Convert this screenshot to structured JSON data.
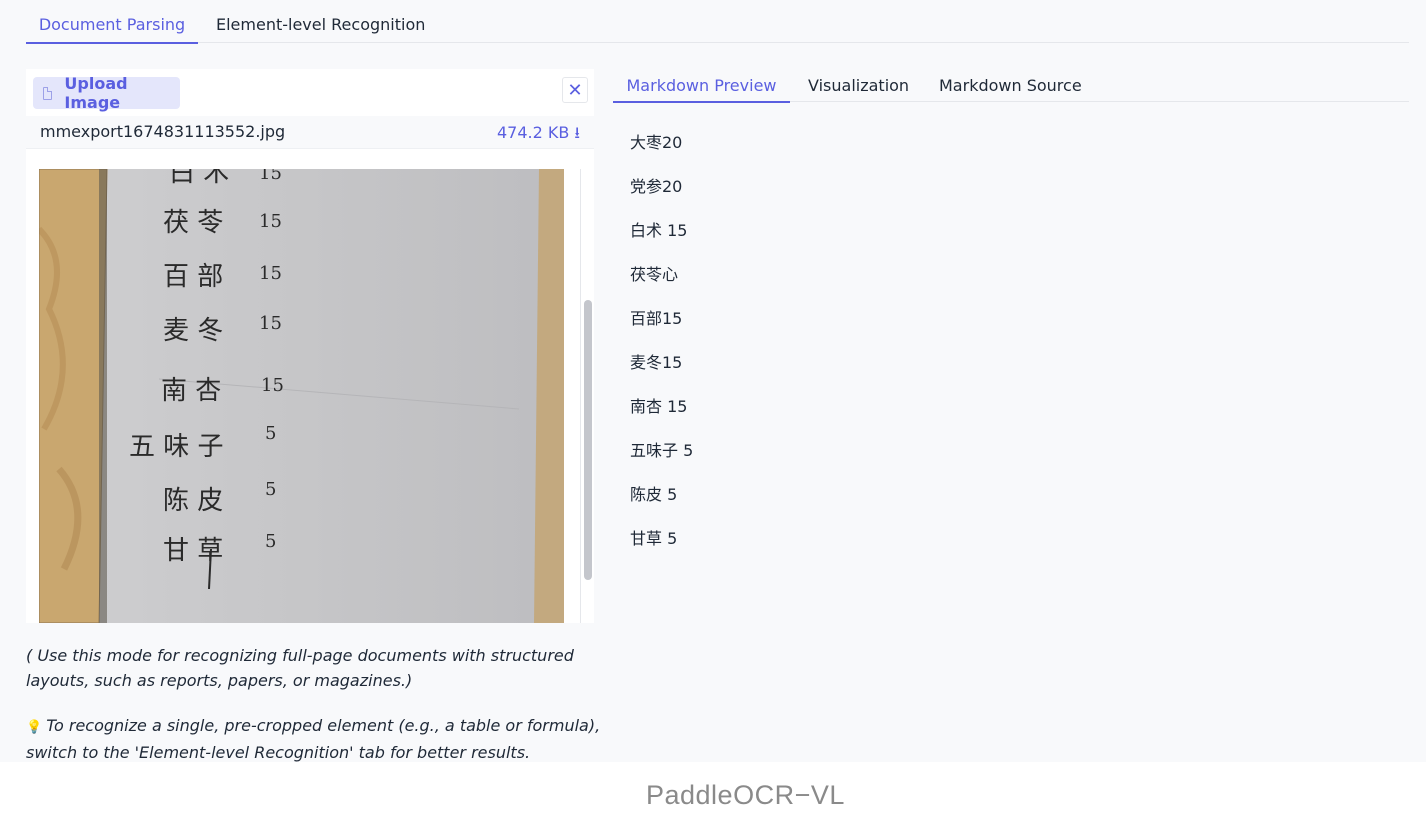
{
  "top_tabs": [
    {
      "label": "Document Parsing",
      "active": true
    },
    {
      "label": "Element-level Recognition",
      "active": false
    }
  ],
  "upload": {
    "button_label": "Upload Image",
    "close_icon": "close-icon",
    "file_name": "mmexport1674831113552.jpg",
    "file_size": "474.2 KB ⭳"
  },
  "image": {
    "handwritten_lines": [
      "白 术 15",
      "茯 苓 15",
      "百 部 15",
      "麦 冬 15",
      "南 杏 15",
      "五 味 子 5",
      "陈 皮 5",
      "甘 草 5"
    ]
  },
  "notes": {
    "mode_hint": "( Use this mode for recognizing full-page documents with structured layouts, such as reports, papers, or magazines.)",
    "tip_icon": "💡",
    "tip_text": "To recognize a single, pre-cropped element (e.g., a table or formula), switch to the 'Element-level Recognition' tab for better results."
  },
  "right_tabs": [
    {
      "label": "Markdown Preview",
      "active": true
    },
    {
      "label": "Visualization",
      "active": false
    },
    {
      "label": "Markdown Source",
      "active": false
    }
  ],
  "markdown_lines": [
    "大枣20",
    "党参20",
    "白术 15",
    "茯苓心",
    "百部15",
    "麦冬15",
    "南杏 15",
    "五味子 5",
    "陈皮 5",
    "甘草 5"
  ],
  "footer": {
    "brand": "PaddleOCR−VL"
  },
  "colors": {
    "accent": "#5a5fe0",
    "accent_bg": "#e4e6fb",
    "panel_bg": "#f8f9fb"
  }
}
